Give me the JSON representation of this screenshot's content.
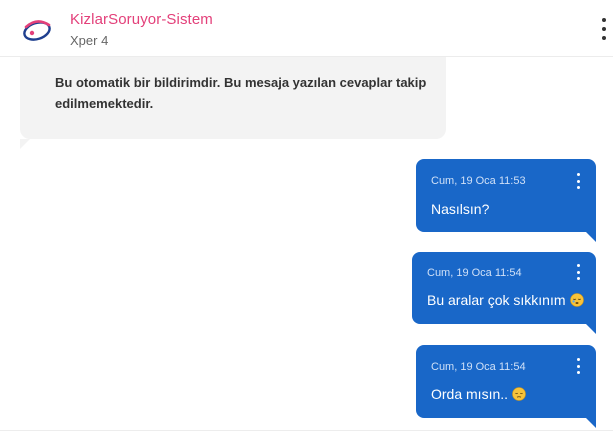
{
  "header": {
    "name": "KizlarSoruyor-Sistem",
    "subtitle": "Xper 4"
  },
  "incoming": {
    "text": "Bu otomatik bir bildirimdir. Bu mesaja yazılan cevaplar takip edilmemektedir."
  },
  "messages": [
    {
      "time": "Cum, 19 Oca 11:53",
      "text": "Nasılsın?",
      "emoji": ""
    },
    {
      "time": "Cum, 19 Oca 11:54",
      "text": "Bu aralar çok sıkkınım",
      "emoji": "sleepy-face-icon"
    },
    {
      "time": "Cum, 19 Oca 11:54",
      "text": "Orda mısın..",
      "emoji": "pensive-face-icon"
    }
  ],
  "colors": {
    "brand_pink": "#e3407a",
    "bubble_blue": "#1967c8",
    "incoming_bg": "#f3f3f3"
  }
}
